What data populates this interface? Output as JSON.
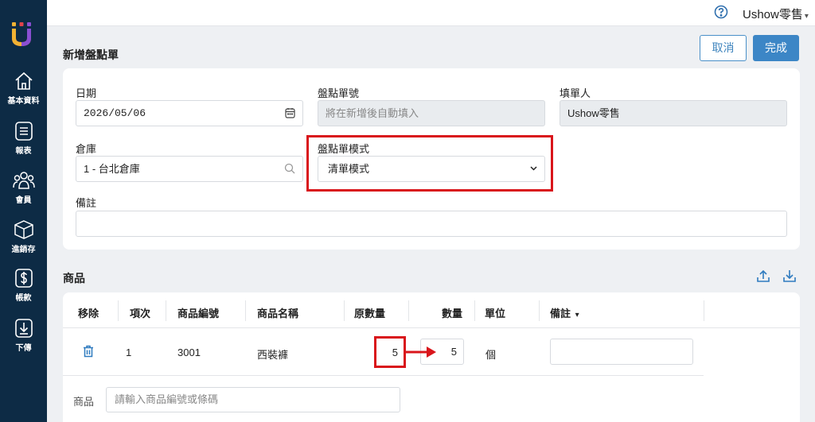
{
  "colors": {
    "sidebar": "#0d2b45",
    "accent": "#3c86c6",
    "highlight": "#d9151b"
  },
  "sidebar": {
    "items": [
      {
        "icon": "home-icon",
        "label": "基本資料"
      },
      {
        "icon": "report-icon",
        "label": "報表"
      },
      {
        "icon": "members-icon",
        "label": "會員"
      },
      {
        "icon": "inventory-box-icon",
        "label": "進銷存"
      },
      {
        "icon": "dollar-icon",
        "label": "帳款"
      },
      {
        "icon": "download-icon",
        "label": "下傳"
      }
    ]
  },
  "topbar": {
    "user_name": "Ushow零售",
    "caret": "▾"
  },
  "page": {
    "title": "新增盤點單",
    "cancel_label": "取消",
    "done_label": "完成"
  },
  "form": {
    "date_label": "日期",
    "date_value": "2026/05/06",
    "number_label": "盤點單號",
    "number_placeholder": "將在新增後自動填入",
    "filler_label": "填單人",
    "filler_value": "Ushow零售",
    "warehouse_label": "倉庫",
    "warehouse_value": "1 - 台北倉庫",
    "mode_label": "盤點單模式",
    "mode_value": "清單模式",
    "note_label": "備註",
    "note_value": ""
  },
  "products": {
    "title": "商品",
    "columns": {
      "remove": "移除",
      "index": "項次",
      "code": "商品編號",
      "name": "商品名稱",
      "orig_qty": "原數量",
      "qty": "數量",
      "unit": "單位",
      "note": "備註",
      "note_caret": "▾"
    },
    "rows": [
      {
        "index": "1",
        "code": "3001",
        "name": "西裝褲",
        "orig_qty": "5",
        "qty": "5",
        "unit": "個",
        "note": ""
      }
    ],
    "add_label": "商品",
    "add_placeholder": "請輸入商品編號或條碼"
  }
}
